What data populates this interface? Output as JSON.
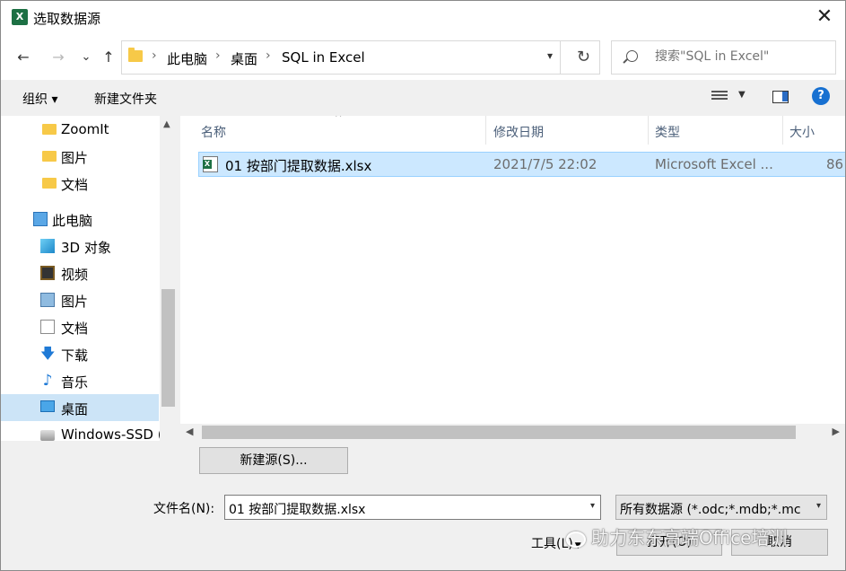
{
  "window": {
    "app_icon": "X",
    "title": "选取数据源",
    "close": "✕"
  },
  "nav": {
    "back": "←",
    "forward": "→",
    "recent": "⌄",
    "up": "↑",
    "breadcrumb": [
      "此电脑",
      "桌面",
      "SQL in Excel"
    ],
    "separator": "›",
    "refresh": "↻",
    "search_placeholder": "搜索\"SQL in Excel\""
  },
  "toolbar": {
    "organize": "组织 ▾",
    "new_folder": "新建文件夹",
    "help": "?"
  },
  "sidebar": {
    "items": [
      {
        "label": "ZoomIt",
        "icon": "folder-icon"
      },
      {
        "label": "图片",
        "icon": "folder-icon"
      },
      {
        "label": "文档",
        "icon": "folder-icon"
      },
      {
        "label": "此电脑",
        "icon": "computer-icon"
      },
      {
        "label": "3D 对象",
        "icon": "3d-objects-icon"
      },
      {
        "label": "视频",
        "icon": "video-icon"
      },
      {
        "label": "图片",
        "icon": "pictures-icon"
      },
      {
        "label": "文档",
        "icon": "document-icon"
      },
      {
        "label": "下载",
        "icon": "download-icon",
        "glyph": "🡇"
      },
      {
        "label": "音乐",
        "icon": "music-icon",
        "glyph": "♪"
      },
      {
        "label": "桌面",
        "icon": "desktop-icon",
        "selected": true
      },
      {
        "label": "Windows-SSD (",
        "icon": "drive-icon"
      }
    ]
  },
  "filelist": {
    "columns": [
      "名称",
      "修改日期",
      "类型",
      "大小"
    ],
    "sort_indicator": "^",
    "rows": [
      {
        "name": "01 按部门提取数据.xlsx",
        "date": "2021/7/5 22:02",
        "type": "Microsoft Excel ...",
        "size": "86"
      }
    ]
  },
  "bottom": {
    "new_source": "新建源(S)...",
    "filename_label": "文件名(N):",
    "filename_value": "01 按部门提取数据.xlsx",
    "filter_value": "所有数据源 (*.odc;*.mdb;*.mc",
    "tools": "工具(L)",
    "open": "打开(O)",
    "cancel": "取消"
  },
  "watermark": "助力东东高端Office培训",
  "colors": {
    "selection": "#cce8ff",
    "nav_selection": "#cce4f7",
    "excel_green": "#1d7044",
    "help_blue": "#1770d1"
  }
}
